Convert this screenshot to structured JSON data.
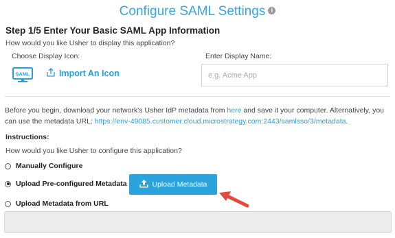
{
  "header": {
    "title": "Configure SAML Settings",
    "info_icon": "info-icon"
  },
  "step": {
    "title": "Step 1/5 Enter Your Basic SAML App Information",
    "subtitle": "How would you like Usher to display this application?"
  },
  "icon_section": {
    "label": "Choose Display Icon:",
    "icon": "saml-monitor-icon",
    "import_label": "Import An Icon"
  },
  "name_section": {
    "label": "Enter Display Name:",
    "placeholder": "e.g. Acme App",
    "value": ""
  },
  "metadata_note": {
    "before": "Before you begin, download your network's Usher IdP metadata from ",
    "link": "here",
    "middle": " and save it your computer. Alternatively, you can use the metadata URL: ",
    "url": "https://env-49085.customer.cloud.microstrategy.com:2443/samlsso/3/metadata",
    "after": "."
  },
  "instructions": {
    "heading": "Instructions:",
    "question": "How would you like Usher to configure this application?",
    "options": [
      {
        "label": "Manually Configure",
        "selected": false
      },
      {
        "label": "Upload Pre-configured Metadata",
        "selected": true
      },
      {
        "label": "Upload Metadata from URL",
        "selected": false
      }
    ],
    "upload_button_label": "Upload Metadata"
  },
  "metadata_url_field": {
    "value": ""
  },
  "colors": {
    "accent": "#2ba3dc",
    "title": "#3aa3d9",
    "arrow": "#e04b3c"
  }
}
